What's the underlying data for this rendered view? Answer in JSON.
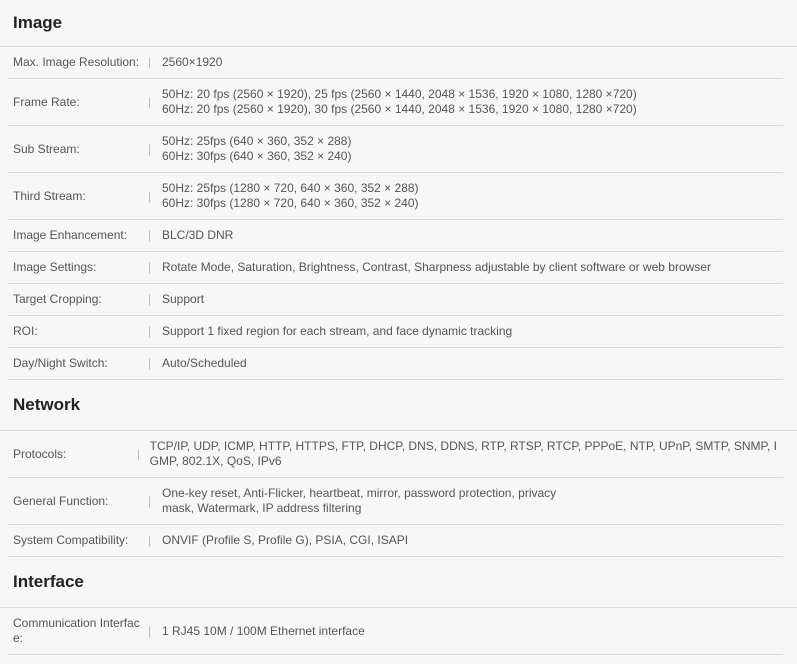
{
  "sections": {
    "image": {
      "title": "Image",
      "rows": [
        {
          "label": "Max. Image Resolution:",
          "lines": [
            "2560×1920"
          ]
        },
        {
          "label": "Frame Rate:",
          "lines": [
            "50Hz: 20 fps (2560 × 1920), 25 fps (2560 × 1440, 2048 × 1536, 1920 × 1080, 1280 ×720)",
            "60Hz: 20 fps (2560 × 1920), 30 fps (2560 × 1440, 2048 × 1536, 1920 × 1080, 1280 ×720)"
          ]
        },
        {
          "label": "Sub Stream:",
          "lines": [
            "50Hz: 25fps (640 × 360, 352 × 288)",
            "60Hz: 30fps (640 × 360, 352 × 240)"
          ]
        },
        {
          "label": "Third Stream:",
          "lines": [
            "50Hz: 25fps (1280 × 720, 640 × 360, 352 × 288)",
            "60Hz: 30fps (1280 × 720, 640 × 360, 352 × 240)"
          ]
        },
        {
          "label": "Image Enhancement:",
          "lines": [
            "BLC/3D DNR"
          ]
        },
        {
          "label": "Image Settings:",
          "lines": [
            "Rotate Mode, Saturation, Brightness, Contrast, Sharpness adjustable by client software or web browser"
          ]
        },
        {
          "label": "Target Cropping:",
          "lines": [
            "Support"
          ]
        },
        {
          "label": "ROI:",
          "lines": [
            "Support 1 fixed region for each stream, and face dynamic tracking"
          ]
        },
        {
          "label": "Day/Night Switch:",
          "lines": [
            "Auto/Scheduled"
          ]
        }
      ]
    },
    "network": {
      "title": "Network",
      "rows": [
        {
          "label": "Protocols:",
          "lines": [
            "TCP/IP, UDP, ICMP, HTTP, HTTPS, FTP, DHCP, DNS, DDNS, RTP, RTSP, RTCP, PPPoE, NTP, UPnP, SMTP, SNMP, I",
            "GMP, 802.1X, QoS, IPv6"
          ]
        },
        {
          "label": "General Function:",
          "lines": [
            "One-key reset, Anti-Flicker, heartbeat, mirror, password protection, privacy",
            "mask, Watermark, IP address filtering"
          ]
        },
        {
          "label": "System Compatibility:",
          "lines": [
            "ONVIF (Profile S, Profile G), PSIA, CGI, ISAPI"
          ]
        }
      ]
    },
    "interface": {
      "title": "Interface",
      "rows": [
        {
          "label_lines": [
            "Communication Interfac",
            "e:"
          ],
          "lines": [
            "1 RJ45 10M / 100M Ethernet interface"
          ]
        }
      ]
    }
  },
  "separator": "|"
}
